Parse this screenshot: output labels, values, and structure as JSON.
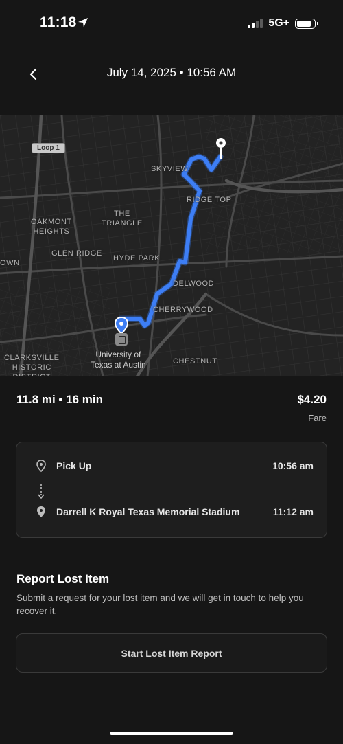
{
  "status_bar": {
    "time": "11:18",
    "network": "5G+",
    "icons": [
      "location-arrow-icon",
      "signal-icon",
      "battery-icon"
    ]
  },
  "header": {
    "title": "July 14, 2025 • 10:56 AM",
    "back_icon": "chevron-left-icon"
  },
  "map": {
    "route_color": "#3d7ef5",
    "highway_badge": "Loop 1",
    "labels": {
      "skyview": "SKYVIEW",
      "ridgetop": "RIDGE TOP",
      "oakmont": "OAKMONT\nHEIGHTS",
      "triangle": "THE\nTRIANGLE",
      "glenridge": "GLEN RIDGE",
      "hydepark": "HYDE PARK",
      "own": "OWN",
      "delwood": "DELWOOD",
      "cherrywood": "CHERRYWOOD",
      "clarksville": "CLARKSVILLE\nHISTORIC\nDISTRICT",
      "chestnut": "CHESTNUT"
    },
    "poi": "University of\nTexas at Austin"
  },
  "trip": {
    "summary": "11.8 mi • 16 min",
    "fare": "$4.20",
    "fare_label": "Fare",
    "pickup": {
      "label": "Pick Up",
      "time": "10:56 am",
      "icon": "origin-pin-icon"
    },
    "dropoff": {
      "label": "Darrell K Royal Texas Memorial Stadium",
      "time": "11:12 am",
      "icon": "destination-pin-icon"
    }
  },
  "lost_item": {
    "title": "Report Lost Item",
    "description": "Submit a request for your lost item and we will get in touch to help you recover it.",
    "button_label": "Start Lost Item Report"
  }
}
